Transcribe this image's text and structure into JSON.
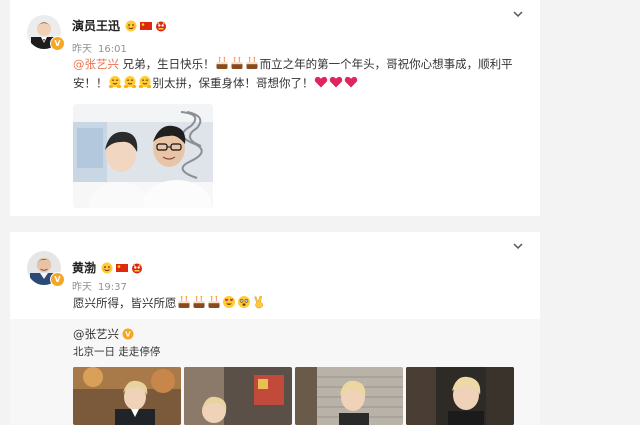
{
  "posts": [
    {
      "username": "演员王迅",
      "time_prefix": "昨天",
      "time": "16:01",
      "mention": "@张艺兴",
      "line1_a": " 兄弟，生日快乐！",
      "line1_b": "而立之年的第一个年头，哥祝你心想事成，顺利平",
      "line2_a": "安！！",
      "line2_b": "别太拼，保重身体！哥想你了！",
      "name_icons": [
        "smiling-emoji-icon",
        "china-flag-icon",
        "lion-dance-icon"
      ]
    },
    {
      "username": "黄渤",
      "time_prefix": "昨天",
      "time": "19:37",
      "text": "愿兴所得，皆兴所愿",
      "name_icons": [
        "smiling-emoji-icon",
        "china-flag-icon",
        "lion-dance-icon"
      ],
      "repost": {
        "author": "@张艺兴",
        "text": "北京一日 走走停停"
      }
    }
  ],
  "icons": {
    "menu": "chevron-down-icon",
    "verified": "verified-badge-icon",
    "cake": "birthday-cake-emoji-icon",
    "hug": "hug-emoji-icon",
    "heart": "red-heart-emoji-icon",
    "hearteyes": "heart-eyes-emoji-icon",
    "starstruck": "star-struck-emoji-icon",
    "victory": "victory-hand-emoji-icon"
  },
  "colors": {
    "mention": "#eb7350",
    "verified": "#f5a623",
    "time": "#939393",
    "heart": "#e0245e"
  }
}
